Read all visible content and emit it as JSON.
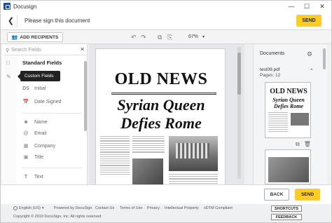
{
  "window": {
    "title": "Docusign",
    "controls": [
      "—",
      "☐",
      "✕"
    ]
  },
  "header": {
    "message": "Please sign this document",
    "send_label": "SEND"
  },
  "toolbar": {
    "add_recipients_label": "ADD RECIPIENTS",
    "zoom": "67%"
  },
  "sidebar": {
    "search_placeholder": "Search Fields",
    "section_title": "Standard Fields",
    "tooltip": "Custom Fields",
    "fields": [
      {
        "label": "Initial",
        "icon": "DS"
      },
      {
        "label": "Date Signed",
        "icon": "calendar-icon"
      },
      {
        "label": "Name",
        "icon": "person-icon"
      },
      {
        "label": "Email",
        "icon": "at-icon"
      },
      {
        "label": "Company",
        "icon": "building-icon"
      },
      {
        "label": "Title",
        "icon": "id-badge-icon"
      },
      {
        "label": "Text",
        "icon": "T"
      }
    ]
  },
  "document": {
    "masthead": "OLD NEWS",
    "headline_line1": "Syrian Queen",
    "headline_line2": "Defies Rome"
  },
  "documents_panel": {
    "title": "Documents",
    "file_name": "test09.pdf",
    "pages": "Pages: 12",
    "thumb_masthead": "OLD NEWS",
    "thumb_headline": "Syrian Queen Defies Rome"
  },
  "actions": {
    "back_label": "BACK",
    "send_label": "SEND"
  },
  "footer": {
    "language": "English (US)",
    "links": [
      "Powered by DocuSign",
      "Contact Us",
      "Terms of Use",
      "Privacy",
      "Intellectual Property",
      "xDTM Compliant"
    ],
    "copyright": "Copyright © 2019 DocuSign, Inc. All rights reserved",
    "shortcuts_label": "SHORTCUTS",
    "feedback_label": "FEEDBACK"
  },
  "colors": {
    "accent": "#ffcc22",
    "logo": "#1e4fa0"
  }
}
